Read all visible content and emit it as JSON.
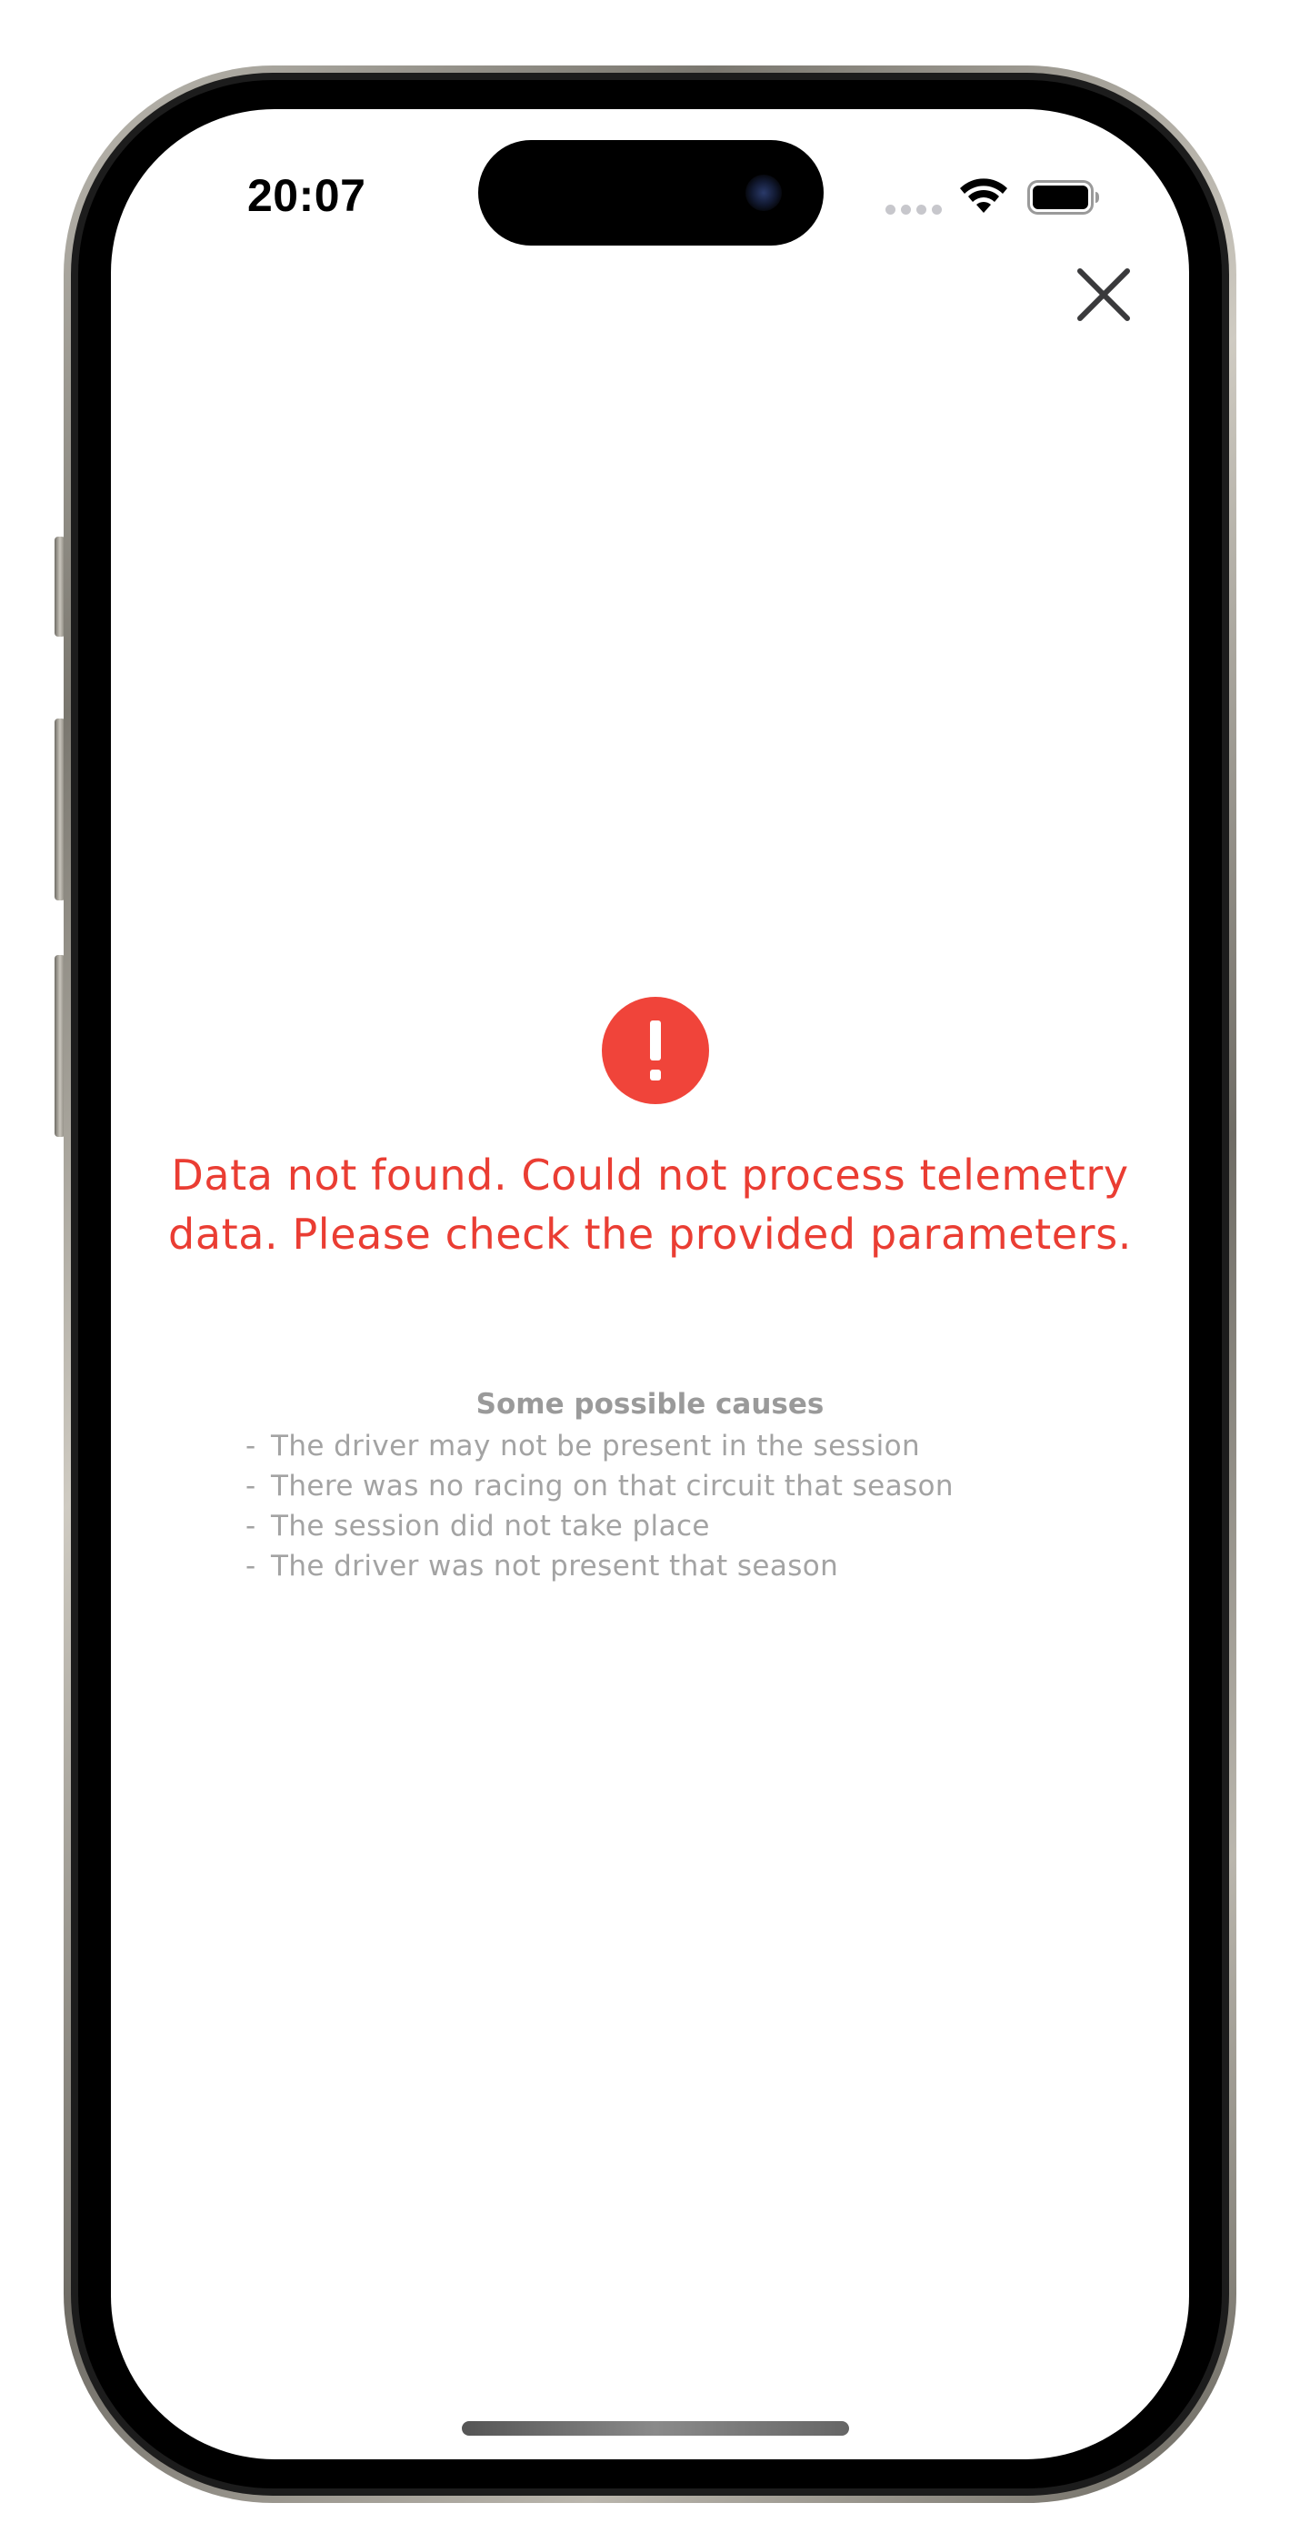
{
  "status_bar": {
    "time": "20:07"
  },
  "icons": {
    "close": "close-icon",
    "error": "exclamation-circle-icon",
    "wifi": "wifi-icon",
    "battery": "battery-icon",
    "signal": "cellular-signal-icon"
  },
  "colors": {
    "error_red": "#ea3d33",
    "muted_text": "#9a9a9a",
    "close_icon": "#3a3a3c"
  },
  "error": {
    "icon_glyph": "!",
    "title": "Data not found. Could not process telemetry data. Please check the provided parameters."
  },
  "causes": {
    "heading": "Some possible causes",
    "bullet": "-",
    "items": [
      "The driver may not be present in the session",
      "There was no racing on that circuit that season",
      "The session did not take place",
      "The driver was not present that season"
    ]
  }
}
